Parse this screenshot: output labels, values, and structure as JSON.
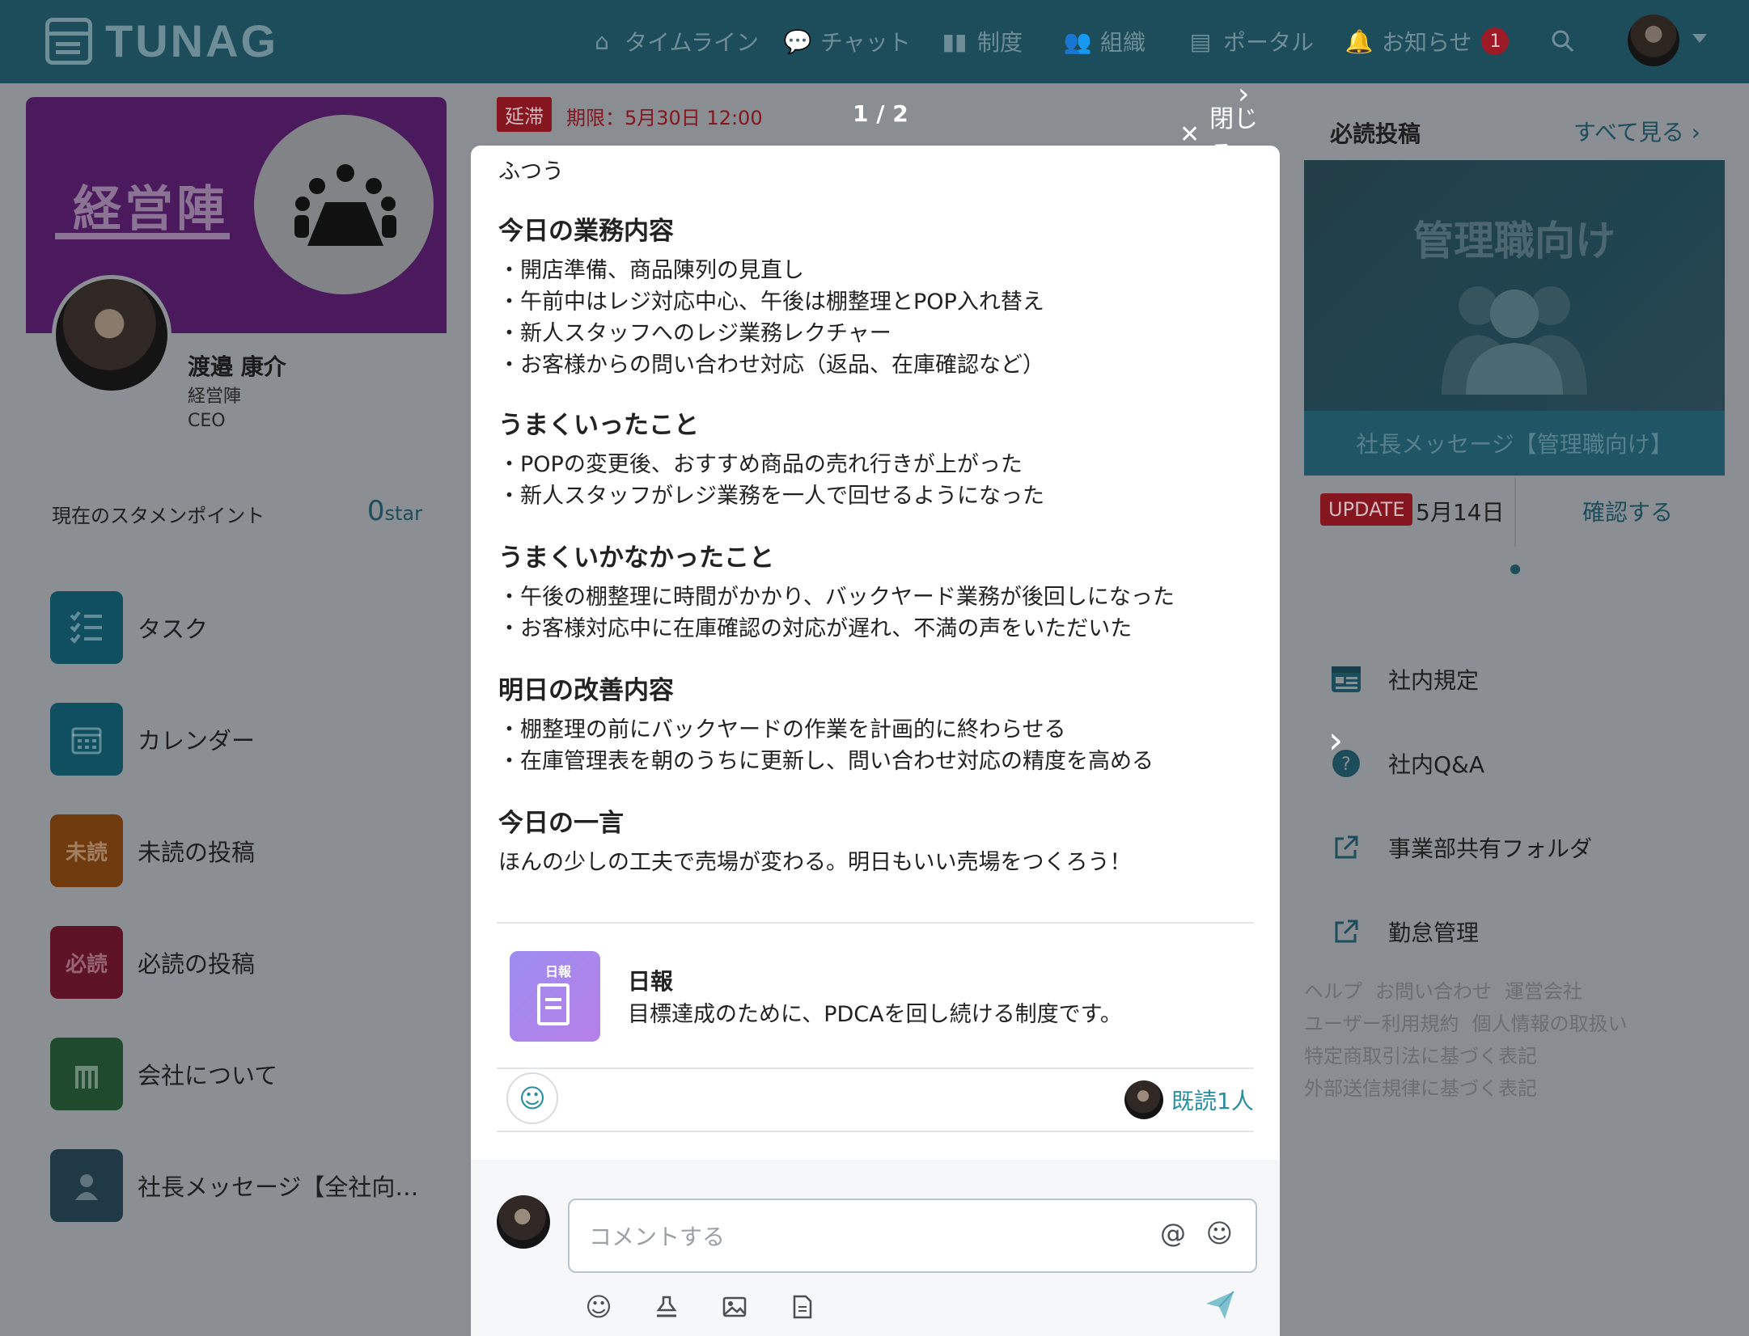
{
  "header": {
    "logo": "TUNAG",
    "nav": [
      {
        "icon": "home-icon",
        "label": "タイムライン"
      },
      {
        "icon": "chat-icon",
        "label": "チャット"
      },
      {
        "icon": "book-icon",
        "label": "制度"
      },
      {
        "icon": "org-icon",
        "label": "組織"
      },
      {
        "icon": "portal-icon",
        "label": "ポータル"
      },
      {
        "icon": "bell-icon",
        "label": "お知らせ",
        "badge": "1"
      }
    ]
  },
  "profile": {
    "department_banner": "経営陣",
    "name": "渡邉 康介",
    "department": "経営陣",
    "role": "CEO"
  },
  "stamen_points": {
    "label": "現在のスタメンポイント",
    "value": "0",
    "unit": "star"
  },
  "menu": [
    {
      "label": "タスク",
      "color": "#0f4f5f",
      "tile_text": ""
    },
    {
      "label": "カレンダー",
      "color": "#0f4f5f",
      "tile_text": ""
    },
    {
      "label": "未読の投稿",
      "color": "#6e3a0e",
      "tile_text": "未読"
    },
    {
      "label": "必読の投稿",
      "color": "#5e1226",
      "tile_text": "必読"
    },
    {
      "label": "会社について",
      "color": "#1f4a2e",
      "tile_text": ""
    },
    {
      "label": "社長メッセージ【全社向…",
      "color": "#1f3a44",
      "tile_text": ""
    }
  ],
  "modal": {
    "overdue_tag": "延滞",
    "deadline": "期限：5月30日 12:00",
    "pager": "1 / 2",
    "close_label": "閉じる",
    "mood": "ふつう",
    "sections": [
      {
        "heading": "今日の業務内容",
        "lines": [
          "・開店準備、商品陳列の見直し",
          "・午前中はレジ対応中心、午後は棚整理とPOP入れ替え",
          "・新人スタッフへのレジ業務レクチャー",
          "・お客様からの問い合わせ対応（返品、在庫確認など）"
        ]
      },
      {
        "heading": "うまくいったこと",
        "lines": [
          "・POPの変更後、おすすめ商品の売れ行きが上がった",
          "・新人スタッフがレジ業務を一人で回せるようになった"
        ]
      },
      {
        "heading": "うまくいかなかったこと",
        "lines": [
          "・午後の棚整理に時間がかかり、バックヤード業務が後回しになった",
          "・お客様対応中に在庫確認の対応が遅れ、不満の声をいただいた"
        ]
      },
      {
        "heading": "明日の改善内容",
        "lines": [
          "・棚整理の前にバックヤードの作業を計画的に終わらせる",
          "・在庫管理表を朝のうちに更新し、問い合わせ対応の精度を高める"
        ]
      },
      {
        "heading": "今日の一言",
        "lines": [
          "ほんの少しの工夫で売場が変わる。明日もいい売場をつくろう！"
        ]
      }
    ],
    "system": {
      "tile_label": "日報",
      "name": "日報",
      "description": "目標達成のために、PDCAを回し続ける制度です。"
    },
    "read_count": "既読1人",
    "comment": {
      "placeholder": "コメントする",
      "value": ""
    }
  },
  "must_read": {
    "title": "必読投稿",
    "see_all": "すべて見る",
    "image_title": "管理職向け",
    "caption": "社長メッセージ【管理職向け】",
    "update_tag": "UPDATE",
    "date": "5月14日",
    "confirm": "確認する"
  },
  "links": [
    {
      "icon": "rules-icon",
      "label": "社内規定"
    },
    {
      "icon": "qa-icon",
      "label": "社内Q&A"
    },
    {
      "icon": "external-link-icon",
      "label": "事業部共有フォルダ"
    },
    {
      "icon": "external-link-icon",
      "label": "勤怠管理"
    }
  ],
  "footer": [
    [
      "ヘルプ",
      "お問い合わせ",
      "運営会社"
    ],
    [
      "ユーザー利用規約",
      "個人情報の取扱い"
    ],
    [
      "特定商取引法に基づく表記"
    ],
    [
      "外部送信規律に基づく表記"
    ]
  ]
}
